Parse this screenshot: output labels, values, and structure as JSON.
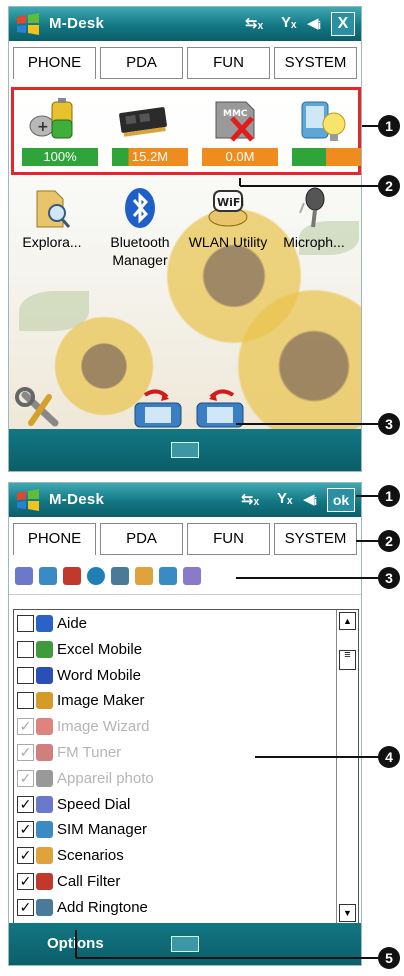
{
  "screen1": {
    "title": "M-Desk",
    "close_label": "X",
    "tabs": [
      "PHONE",
      "PDA",
      "FUN",
      "SYSTEM"
    ],
    "status": {
      "battery": "100%",
      "memory": "15.2M",
      "storage": "0.0M",
      "backlight_level": 0.45
    },
    "apps": [
      "Explora...",
      "Bluetooth Manager",
      "WLAN Utility",
      "Microph..."
    ],
    "storage_icon_text": "MMC",
    "wlan_icon_text": "WiFi"
  },
  "screen2": {
    "title": "M-Desk",
    "ok_label": "ok",
    "tabs": [
      "PHONE",
      "PDA",
      "FUN",
      "SYSTEM"
    ],
    "list": [
      {
        "label": "Aide",
        "checked": false,
        "disabled": false,
        "icon": "help-icon",
        "color": "#2a63c8"
      },
      {
        "label": "Excel Mobile",
        "checked": false,
        "disabled": false,
        "icon": "excel-icon",
        "color": "#3e9a3a"
      },
      {
        "label": "Word Mobile",
        "checked": false,
        "disabled": false,
        "icon": "word-icon",
        "color": "#2a4fb5"
      },
      {
        "label": "Image Maker",
        "checked": false,
        "disabled": false,
        "icon": "palette-icon",
        "color": "#d49a2a"
      },
      {
        "label": "Image Wizard",
        "checked": true,
        "disabled": true,
        "icon": "wizard-icon",
        "color": "#c8322a"
      },
      {
        "label": "FM Tuner",
        "checked": true,
        "disabled": true,
        "icon": "radio-icon",
        "color": "#b02a2a"
      },
      {
        "label": "Appareil photo",
        "checked": true,
        "disabled": true,
        "icon": "camera-icon",
        "color": "#555555"
      },
      {
        "label": "Speed Dial",
        "checked": true,
        "disabled": false,
        "icon": "speed-dial-icon",
        "color": "#6a79c9"
      },
      {
        "label": "SIM Manager",
        "checked": true,
        "disabled": false,
        "icon": "sim-icon",
        "color": "#3a8ac4"
      },
      {
        "label": "Scenarios",
        "checked": true,
        "disabled": false,
        "icon": "scenarios-icon",
        "color": "#e0a23a"
      },
      {
        "label": "Call Filter",
        "checked": true,
        "disabled": false,
        "icon": "call-filter-icon",
        "color": "#c0392b"
      },
      {
        "label": "Add Ringtone",
        "checked": true,
        "disabled": false,
        "icon": "ringtone-icon",
        "color": "#4a7a9a"
      }
    ],
    "softkey_left": "Options"
  },
  "callouts": [
    "1",
    "2",
    "3",
    "1",
    "2",
    "3",
    "4",
    "5"
  ],
  "colors": {
    "titlebar": "#127783",
    "status_border": "#e5262a",
    "green": "#2fa43a",
    "orange": "#f08c1e"
  }
}
